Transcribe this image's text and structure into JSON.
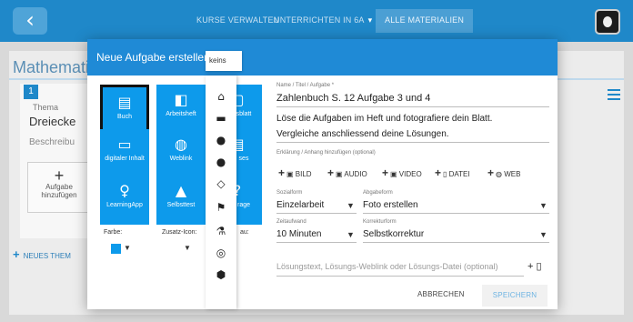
{
  "topbar": {
    "back_glyph": "‹",
    "nav": {
      "kurse": "KURSE VERWALTEN",
      "unterrichten": "UNTERRICHTEN IN 6A",
      "alle": "ALLE MATERIALIEN"
    },
    "caret": "▾"
  },
  "background": {
    "page_title": "Mathemati",
    "thema_number": "1",
    "thema_label": "Thema",
    "thema_value": "Dreiecke",
    "beschreibung": "Beschreibu",
    "aufgabe_line1": "Aufgabe",
    "aufgabe_line2": "hinzufügen",
    "neues_thema": "NEUES THEM"
  },
  "modal": {
    "title": "Neue Aufgabe erstellen",
    "types": [
      {
        "label": "Buch",
        "icon": "book-icon",
        "glyph": "▤"
      },
      {
        "label": "Arbeitsheft",
        "icon": "workbook-icon",
        "glyph": "◧"
      },
      {
        "label": "sblatt",
        "icon": "worksheet-icon",
        "glyph": "▢"
      },
      {
        "label": "digitaler Inhalt",
        "icon": "laptop-icon",
        "glyph": "▭"
      },
      {
        "label": "Weblink",
        "icon": "globe-icon",
        "glyph": "◍"
      },
      {
        "label": "ses",
        "icon": "document-icon",
        "glyph": "▤"
      },
      {
        "label": "LearningApp",
        "icon": "lightbulb-icon",
        "glyph": "♀"
      },
      {
        "label": "Selbsttest",
        "icon": "graduation-cap-icon",
        "glyph": "▲"
      },
      {
        "label": "rage",
        "icon": "question-icon",
        "glyph": "?"
      }
    ],
    "farbe_label": "Farbe:",
    "zusatz_label": "Zusatz-Icon:",
    "rau_label": "au:",
    "dropdown": {
      "selected": "keins",
      "icons": [
        {
          "name": "home-icon",
          "glyph": "⌂"
        },
        {
          "name": "archive-icon",
          "glyph": "▬"
        },
        {
          "name": "comment-icon",
          "glyph": "●"
        },
        {
          "name": "comments-icon",
          "glyph": "●"
        },
        {
          "name": "diamond-icon",
          "glyph": "◇"
        },
        {
          "name": "flag-icon",
          "glyph": "⚑"
        },
        {
          "name": "flask-icon",
          "glyph": "⚗"
        },
        {
          "name": "target-icon",
          "glyph": "◎"
        },
        {
          "name": "cube-icon",
          "glyph": "⬢"
        }
      ]
    },
    "form": {
      "name_label": "Name / Titel / Aufgabe *",
      "name_value": "Zahlenbuch S. 12 Aufgabe 3 und 4",
      "desc_line1": "Löse die Aufgaben im Heft und fotografiere dein Blatt.",
      "desc_line2": "Vergleiche anschliessend deine Lösungen.",
      "erklaerung_label": "Erklärung / Anhang hinzufügen (optional)",
      "attachments": [
        "BILD",
        "AUDIO",
        "VIDEO",
        "DATEI",
        "WEB"
      ],
      "sozialform_label": "Sozialform",
      "sozialform_value": "Einzelarbeit",
      "abgabeform_label": "Abgabeform",
      "abgabeform_value": "Foto erstellen",
      "zeitaufwand_label": "Zeitaufwand",
      "zeitaufwand_value": "10 Minuten",
      "korrekturform_label": "Korrekturform",
      "korrekturform_value": "Selbstkorrektur",
      "loesung_placeholder": "Lösungstext, Lösungs-Weblink oder Lösungs-Datei (optional)",
      "cancel": "ABBRECHEN",
      "save": "SPEICHERN"
    }
  },
  "colors": {
    "primary": "#1f88c9",
    "tile": "#0d9aeb",
    "header": "#1f8ad6"
  }
}
